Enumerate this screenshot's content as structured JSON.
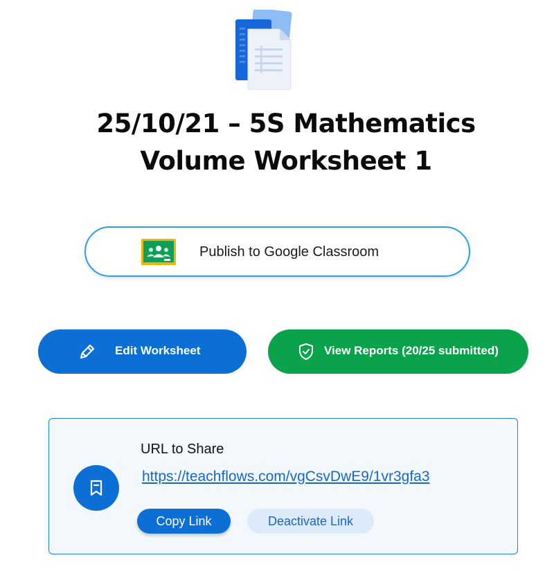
{
  "document": {
    "icon": "google-docs-icon",
    "title_line1": "25/10/21 – 5S Mathematics",
    "title_line2": "Volume Worksheet 1"
  },
  "publish": {
    "label": "Publish to Google Classroom",
    "icon": "google-classroom-icon"
  },
  "actions": {
    "edit_label": "Edit Worksheet",
    "edit_icon": "pencil-icon",
    "reports_label": "View Reports (20/25 submitted)",
    "reports_icon": "shield-check-icon"
  },
  "share": {
    "heading": "URL to Share",
    "url": "https://teachflows.com/vgCsvDwE9/1vr3gfa3",
    "icon": "bookmark-icon",
    "copy_label": "Copy Link",
    "deactivate_label": "Deactivate Link"
  },
  "colors": {
    "primary_blue": "#0b6fd6",
    "success_green": "#0aa24a",
    "outline_blue": "#2c9bea",
    "share_bg": "#f3f8fd"
  }
}
